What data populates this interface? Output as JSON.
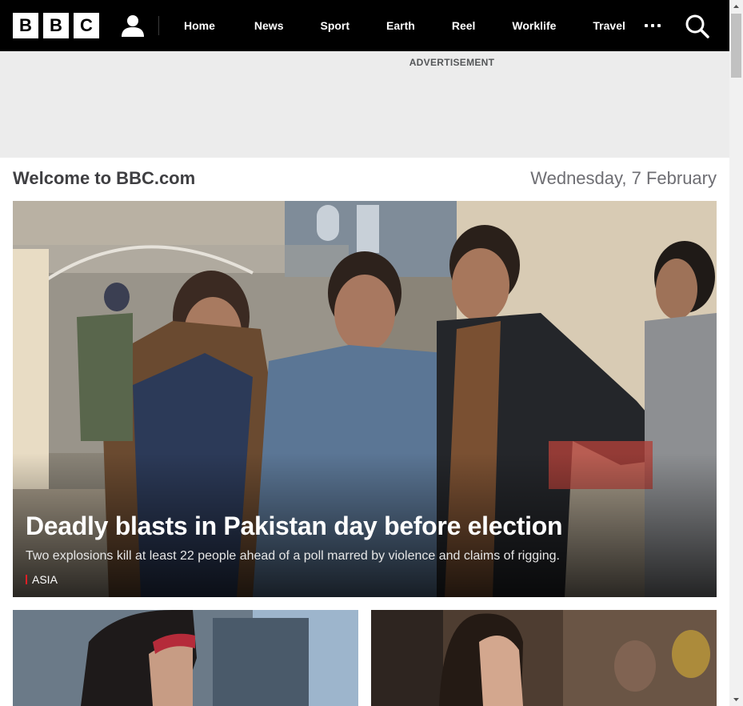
{
  "header": {
    "logo": [
      "B",
      "B",
      "C"
    ],
    "account_icon": "user-icon",
    "nav_items": [
      "Home",
      "News",
      "Sport",
      "Earth",
      "Reel",
      "Worklife",
      "Travel"
    ],
    "more_icon": "more-dots-icon",
    "search_icon": "search-icon"
  },
  "ad": {
    "label": "ADVERTISEMENT"
  },
  "welcome": {
    "title": "Welcome to BBC.com",
    "date": "Wednesday, 7 February"
  },
  "hero": {
    "headline": "Deadly blasts in Pakistan day before election",
    "summary": "Two explosions kill at least 22 people ahead of a poll marred by violence and claims of rigging.",
    "tag": "ASIA",
    "tag_color": "#e01f26"
  },
  "colors": {
    "nav_bg": "#000000",
    "ad_bg": "#ececec",
    "accent": "#e01f26"
  }
}
